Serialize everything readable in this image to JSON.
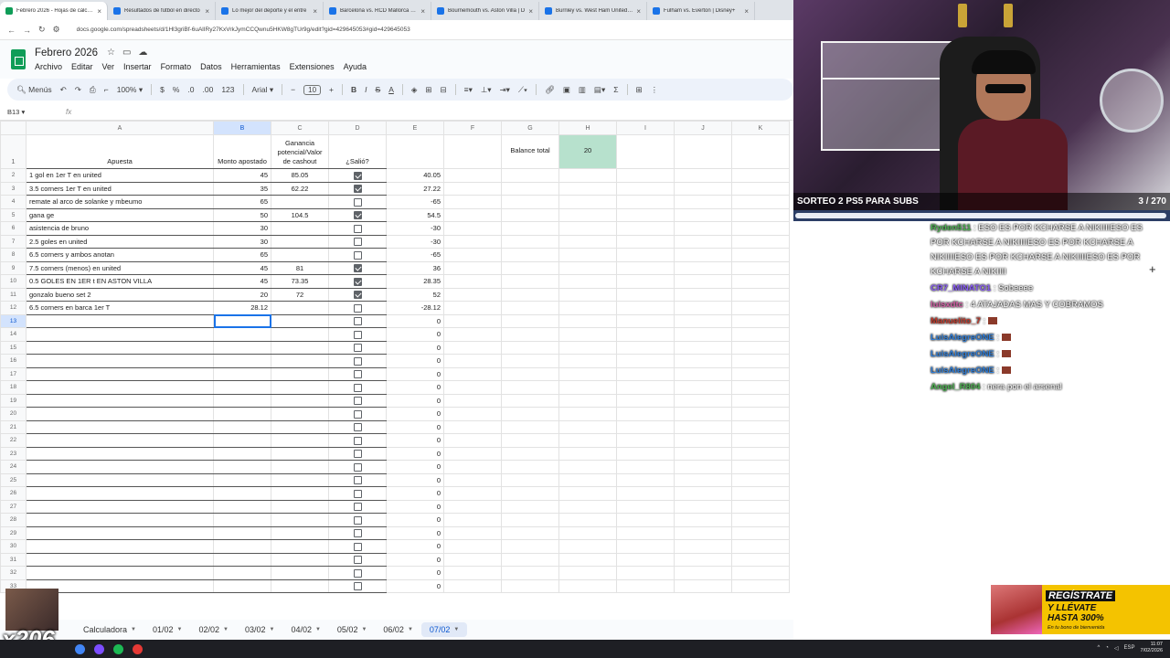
{
  "browser": {
    "tabs": [
      {
        "title": "Febrero 2026 - Hojas de cálculo",
        "active": true,
        "icon": "sheets-icon"
      },
      {
        "title": "Resultados de fútbol en directo",
        "active": false,
        "icon": "globe-icon"
      },
      {
        "title": "Lo mejor del deporte y el entre",
        "active": false,
        "icon": "globe-icon"
      },
      {
        "title": "Barcelona vs. RCD Mallorca | D",
        "active": false,
        "icon": "globe-icon"
      },
      {
        "title": "Bournemouth vs. Aston Villa | D",
        "active": false,
        "icon": "globe-icon"
      },
      {
        "title": "Burnley vs. West Ham United | D",
        "active": false,
        "icon": "globe-icon"
      },
      {
        "title": "Fulham vs. Everton | Disney+",
        "active": false,
        "icon": "globe-icon"
      }
    ],
    "url": "docs.google.com/spreadsheets/d/1Hl3griBf-6uAlIRy27KxVrkJymCCQwnu5HKW8gTUr9g/edit?gid=429645053#gid=429645053"
  },
  "doc": {
    "title": "Febrero 2026",
    "menu": [
      "Archivo",
      "Editar",
      "Ver",
      "Insertar",
      "Formato",
      "Datos",
      "Herramientas",
      "Extensiones",
      "Ayuda"
    ]
  },
  "toolbar": {
    "search_label": "Menús",
    "zoom": "100%",
    "currency": "$",
    "percent": "%",
    "dec_dec": ".0",
    "dec_inc": ".00",
    "number_format": "123",
    "font": "Arial",
    "font_size": "10"
  },
  "formula_bar": {
    "name_box": "B13",
    "fx": "fx",
    "content": ""
  },
  "grid": {
    "columns": [
      "A",
      "B",
      "C",
      "D",
      "E",
      "F",
      "G",
      "H",
      "I",
      "J",
      "K"
    ],
    "headers": {
      "a": "Apuesta",
      "b": "Monto apostado",
      "c": "Ganancia potencial/Valor de cashout",
      "d": "¿Salió?"
    },
    "balance_label": "Balance total",
    "balance_value": "20",
    "rows": [
      {
        "n": "2",
        "a": "1 gol en 1er T en united",
        "b": "45",
        "c": "85.05",
        "d": true,
        "e": "40.05"
      },
      {
        "n": "3",
        "a": "3.5 corners 1er T en united",
        "b": "35",
        "c": "62.22",
        "d": true,
        "e": "27.22"
      },
      {
        "n": "4",
        "a": "remate al arco de solanke y mbeumo",
        "b": "65",
        "c": "",
        "d": false,
        "e": "-65"
      },
      {
        "n": "5",
        "a": "gana ge",
        "b": "50",
        "c": "104.5",
        "d": true,
        "e": "54.5"
      },
      {
        "n": "6",
        "a": "asistencia de bruno",
        "b": "30",
        "c": "",
        "d": false,
        "e": "-30"
      },
      {
        "n": "7",
        "a": "2.5 goles en united",
        "b": "30",
        "c": "",
        "d": false,
        "e": "-30"
      },
      {
        "n": "8",
        "a": "6.5 corners y ambos anotan",
        "b": "65",
        "c": "",
        "d": false,
        "e": "-65"
      },
      {
        "n": "9",
        "a": "7.5 corners (menos) en united",
        "b": "45",
        "c": "81",
        "d": true,
        "e": "36"
      },
      {
        "n": "10",
        "a": "0.5 GOLES EN 1ER t EN ASTON VILLA",
        "b": "45",
        "c": "73.35",
        "d": true,
        "e": "28.35"
      },
      {
        "n": "11",
        "a": "gonzalo bueno set 2",
        "b": "20",
        "c": "72",
        "d": true,
        "e": "52"
      },
      {
        "n": "12",
        "a": "6.5 corners en barca 1er T",
        "b": "28.12",
        "c": "",
        "d": false,
        "e": "-28.12"
      },
      {
        "n": "13",
        "a": "",
        "b": "",
        "c": "",
        "d": false,
        "e": "0"
      },
      {
        "n": "14",
        "a": "",
        "b": "",
        "c": "",
        "d": false,
        "e": "0"
      },
      {
        "n": "15",
        "a": "",
        "b": "",
        "c": "",
        "d": false,
        "e": "0"
      },
      {
        "n": "16",
        "a": "",
        "b": "",
        "c": "",
        "d": false,
        "e": "0"
      },
      {
        "n": "17",
        "a": "",
        "b": "",
        "c": "",
        "d": false,
        "e": "0"
      },
      {
        "n": "18",
        "a": "",
        "b": "",
        "c": "",
        "d": false,
        "e": "0"
      },
      {
        "n": "19",
        "a": "",
        "b": "",
        "c": "",
        "d": false,
        "e": "0"
      },
      {
        "n": "20",
        "a": "",
        "b": "",
        "c": "",
        "d": false,
        "e": "0"
      },
      {
        "n": "21",
        "a": "",
        "b": "",
        "c": "",
        "d": false,
        "e": "0"
      },
      {
        "n": "22",
        "a": "",
        "b": "",
        "c": "",
        "d": false,
        "e": "0"
      },
      {
        "n": "23",
        "a": "",
        "b": "",
        "c": "",
        "d": false,
        "e": "0"
      },
      {
        "n": "24",
        "a": "",
        "b": "",
        "c": "",
        "d": false,
        "e": "0"
      },
      {
        "n": "25",
        "a": "",
        "b": "",
        "c": "",
        "d": false,
        "e": "0"
      },
      {
        "n": "26",
        "a": "",
        "b": "",
        "c": "",
        "d": false,
        "e": "0"
      },
      {
        "n": "27",
        "a": "",
        "b": "",
        "c": "",
        "d": false,
        "e": "0"
      },
      {
        "n": "28",
        "a": "",
        "b": "",
        "c": "",
        "d": false,
        "e": "0"
      },
      {
        "n": "29",
        "a": "",
        "b": "",
        "c": "",
        "d": false,
        "e": "0"
      },
      {
        "n": "30",
        "a": "",
        "b": "",
        "c": "",
        "d": false,
        "e": "0"
      },
      {
        "n": "31",
        "a": "",
        "b": "",
        "c": "",
        "d": false,
        "e": "0"
      },
      {
        "n": "32",
        "a": "",
        "b": "",
        "c": "",
        "d": false,
        "e": "0"
      },
      {
        "n": "33",
        "a": "",
        "b": "",
        "c": "",
        "d": false,
        "e": "0"
      }
    ]
  },
  "sheet_tabs": [
    {
      "label": "Calculadora",
      "active": false
    },
    {
      "label": "01/02",
      "active": false
    },
    {
      "label": "02/02",
      "active": false
    },
    {
      "label": "03/02",
      "active": false
    },
    {
      "label": "04/02",
      "active": false
    },
    {
      "label": "05/02",
      "active": false
    },
    {
      "label": "06/02",
      "active": false
    },
    {
      "label": "07/02",
      "active": true
    }
  ],
  "stream": {
    "banner": "SORTEO 2 PS5 PARA SUBS",
    "counter": "3 / 270",
    "chat": [
      {
        "user": "Ryden511",
        "color": "#4caf50",
        "text": ": ESO ES POR KCHARSE A NIKIIIIESO ES POR KCHARSE A NIKIIIIESO ES POR KCHARSE A NIKIIIIESO ES POR KCHARSE A NIKIIIIESO ES POR KCHARSE A NIKIIII",
        "emotes": 0
      },
      {
        "user": "CR7_MINATO1",
        "color": "#8a5cf6",
        "text": ": Sobeeee",
        "emotes": 0
      },
      {
        "user": "luisxdtc",
        "color": "#d35fa5",
        "text": ": 4 ATAJADAS MAS Y COBRAMOS",
        "emotes": 0
      },
      {
        "user": "Manuelito_7",
        "color": "#c0392b",
        "text": ":",
        "emotes": 1
      },
      {
        "user": "LuisAlegreONE",
        "color": "#2e7dd7",
        "text": ":",
        "emotes": 1
      },
      {
        "user": "LuisAlegreONE",
        "color": "#2e7dd7",
        "text": ":",
        "emotes": 1
      },
      {
        "user": "LuisAlegreONE",
        "color": "#2e7dd7",
        "text": ":",
        "emotes": 1
      },
      {
        "user": "Angel_R804",
        "color": "#4caf50",
        "text": ": nera pon el arsenal",
        "emotes": 0
      }
    ],
    "promo": {
      "line1": "REGÍSTRATE",
      "line2": "Y LLÉVATE",
      "line3": "HASTA 300%",
      "line4": "En tu bono de bienvenida"
    },
    "multiplier": "x206"
  },
  "taskbar": {
    "lang": "ESP",
    "time": "11:07",
    "date": "7/02/2026"
  }
}
